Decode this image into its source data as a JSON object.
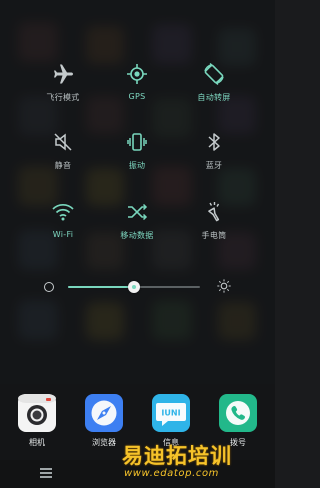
{
  "accent_color": "#79d7bd",
  "quick_settings": [
    {
      "label": "飞行模式",
      "icon": "airplane-icon",
      "active": false
    },
    {
      "label": "GPS",
      "icon": "gps-icon",
      "active": true
    },
    {
      "label": "自动转屏",
      "icon": "auto-rotate-icon",
      "active": true
    },
    {
      "label": "静音",
      "icon": "mute-icon",
      "active": false
    },
    {
      "label": "振动",
      "icon": "vibrate-icon",
      "active": true
    },
    {
      "label": "蓝牙",
      "icon": "bluetooth-icon",
      "active": false
    },
    {
      "label": "Wi-Fi",
      "icon": "wifi-icon",
      "active": true
    },
    {
      "label": "移动数据",
      "icon": "mobile-data-icon",
      "active": true
    },
    {
      "label": "手电筒",
      "icon": "flashlight-icon",
      "active": false
    }
  ],
  "brightness": {
    "level": 0.5
  },
  "dock": [
    {
      "name": "相机",
      "icon": "camera-icon",
      "color": "#f4f4f4"
    },
    {
      "name": "浏览器",
      "icon": "compass-icon",
      "color": "#3d7ff2"
    },
    {
      "name": "信息",
      "icon": "message-icon",
      "color": "#2fb4e8",
      "badge_text": "IUNI"
    },
    {
      "name": "拨号",
      "icon": "phone-icon",
      "color": "#22b88a"
    }
  ],
  "watermark": {
    "title": "易迪拓培训",
    "url": "www.edatop.com"
  }
}
